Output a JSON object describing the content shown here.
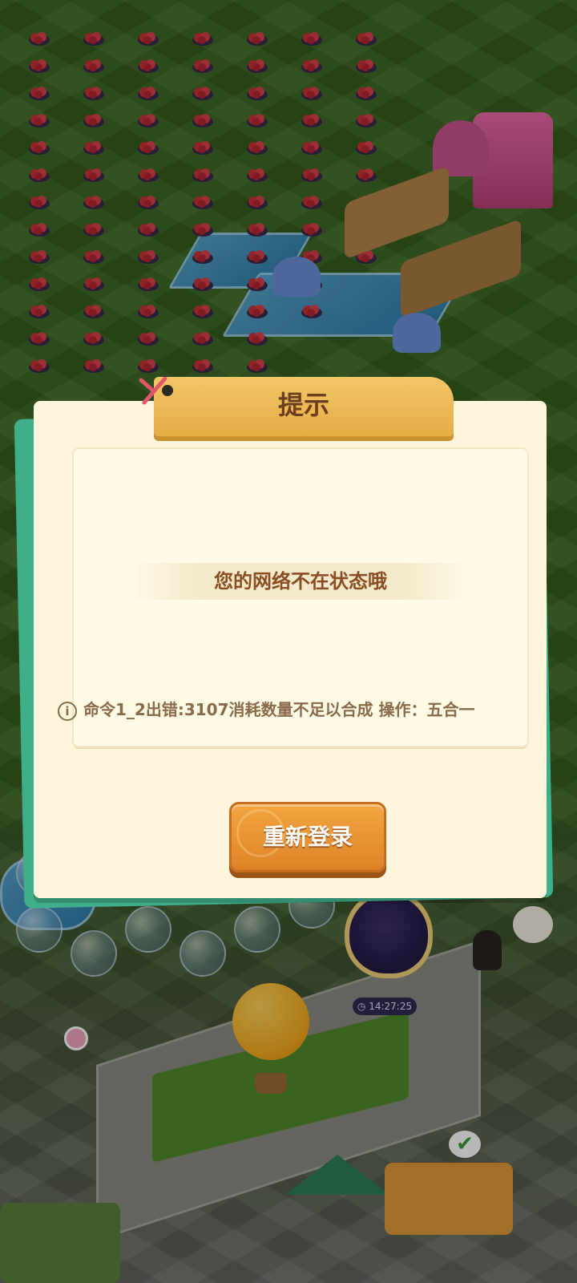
{
  "dialog": {
    "title": "提示",
    "message": "您的网络不在状态哦",
    "error_text": "命令1_2出错:3107消耗数量不足以合成  操作：五合一",
    "info_icon": "i",
    "relogin_label": "重新登录"
  },
  "world": {
    "timer_text": "14:27:25"
  },
  "colors": {
    "panel": "#fdf6dc",
    "title_tab": "#e6ad45",
    "button": "#de8228",
    "panel_back": "#3fae8a",
    "message_text": "#8a4e24"
  }
}
